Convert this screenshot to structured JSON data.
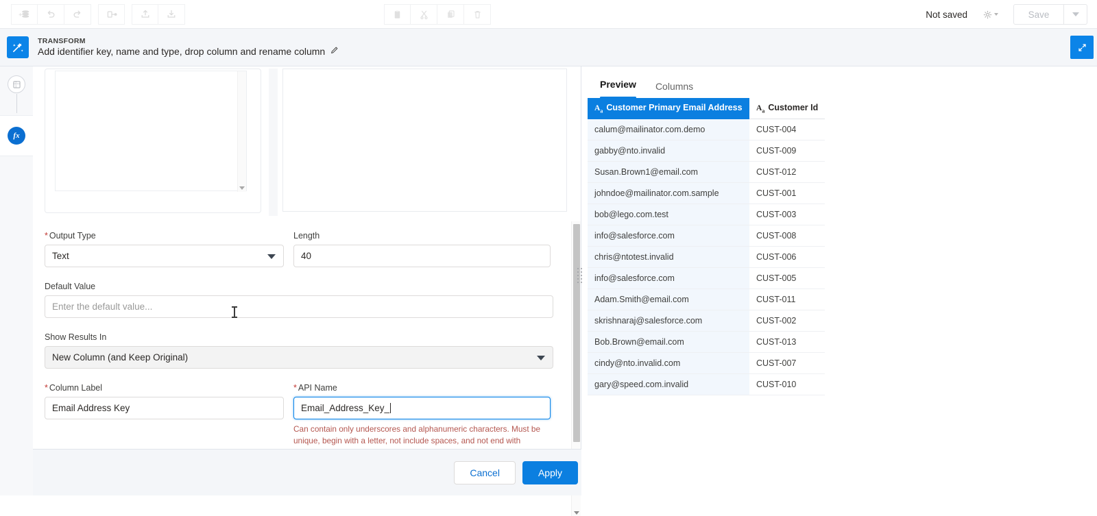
{
  "toolbar": {
    "left_buttons": [
      {
        "name": "add-dataset-icon",
        "title": "Add dataset"
      },
      {
        "name": "undo-icon",
        "title": "Undo"
      },
      {
        "name": "redo-icon",
        "title": "Redo"
      },
      {
        "name": "branch-icon",
        "title": "Branch"
      },
      {
        "name": "upload-icon",
        "title": "Upload"
      },
      {
        "name": "download-icon",
        "title": "Download"
      }
    ],
    "center_buttons": [
      {
        "name": "paste-icon",
        "title": "Paste"
      },
      {
        "name": "cut-icon",
        "title": "Cut"
      },
      {
        "name": "copy-icon",
        "title": "Copy"
      },
      {
        "name": "delete-icon",
        "title": "Delete"
      }
    ],
    "status_text": "Not saved",
    "save_label": "Save"
  },
  "transform": {
    "kicker": "TRANSFORM",
    "title": "Add identifier key, name and type, drop column and rename column",
    "edit_icon": "pencil-icon",
    "node_icon": "table-node-icon",
    "formula_icon": "fx",
    "expand_icon": "expand-icon"
  },
  "form": {
    "output_type": {
      "label": "Output Type",
      "required": true,
      "value": "Text"
    },
    "length": {
      "label": "Length",
      "required": false,
      "value": "40"
    },
    "default_value": {
      "label": "Default Value",
      "required": false,
      "value": "",
      "placeholder": "Enter the default value..."
    },
    "show_results_in": {
      "label": "Show Results In",
      "required": false,
      "value": "New Column (and Keep Original)"
    },
    "column_label": {
      "label": "Column Label",
      "required": true,
      "value": "Email Address Key"
    },
    "api_name": {
      "label": "API Name",
      "required": true,
      "value": "Email_Address_Key_",
      "error": "Can contain only underscores and alphanumeric characters. Must be unique, begin with a letter, not include spaces, and not end with"
    }
  },
  "footer": {
    "cancel_label": "Cancel",
    "apply_label": "Apply"
  },
  "preview": {
    "tabs": [
      {
        "label": "Preview",
        "active": true
      },
      {
        "label": "Columns",
        "active": false
      }
    ],
    "columns": [
      {
        "name": "Customer Primary Email Address",
        "type_icon": "text-type-icon",
        "highlighted": true
      },
      {
        "name": "Customer Id",
        "type_icon": "text-type-icon",
        "highlighted": false
      }
    ],
    "rows": [
      [
        "calum@mailinator.com.demo",
        "CUST-004"
      ],
      [
        "gabby@nto.invalid",
        "CUST-009"
      ],
      [
        "Susan.Brown1@email.com",
        "CUST-012"
      ],
      [
        "johndoe@mailinator.com.sample",
        "CUST-001"
      ],
      [
        "bob@lego.com.test",
        "CUST-003"
      ],
      [
        "info@salesforce.com",
        "CUST-008"
      ],
      [
        "chris@ntotest.invalid",
        "CUST-006"
      ],
      [
        "info@salesforce.com",
        "CUST-005"
      ],
      [
        "Adam.Smith@email.com",
        "CUST-011"
      ],
      [
        "skrishnaraj@salesforce.com",
        "CUST-002"
      ],
      [
        "Bob.Brown@email.com",
        "CUST-013"
      ],
      [
        "cindy@nto.invalid.com",
        "CUST-007"
      ],
      [
        "gary@speed.com.invalid",
        "CUST-010"
      ]
    ]
  },
  "colors": {
    "accent_blue": "#0b7fe0",
    "header_blue": "#0b7fe0",
    "error_red": "#b4564f",
    "panel_grey": "#f4f6f9"
  }
}
